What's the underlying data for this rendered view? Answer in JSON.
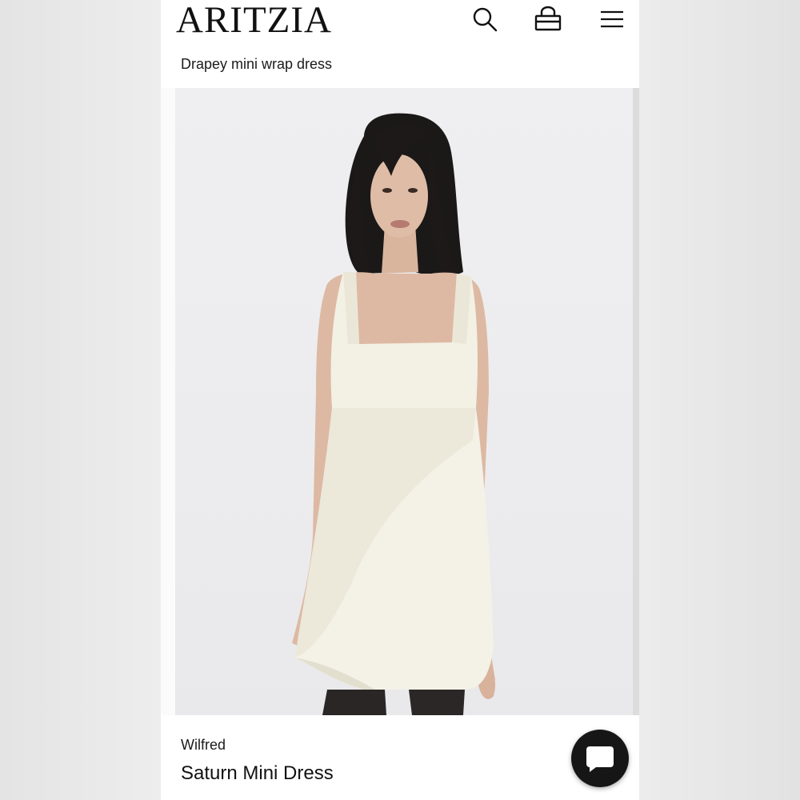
{
  "header": {
    "logo_text": "ARITZIA",
    "icons": [
      "search-icon",
      "shopping-bag-icon",
      "menu-icon"
    ]
  },
  "page": {
    "subtitle": "Drapey mini wrap dress"
  },
  "product": {
    "brand": "Wilfred",
    "name": "Saturn Mini Dress",
    "image": "model-in-ivory-mini-wrap-dress"
  },
  "chat": {
    "icon": "chat-bubble-icon"
  },
  "colors": {
    "text": "#111111",
    "background": "#ffffff",
    "chat_button": "#161616",
    "dress": "#f3f0e4"
  }
}
